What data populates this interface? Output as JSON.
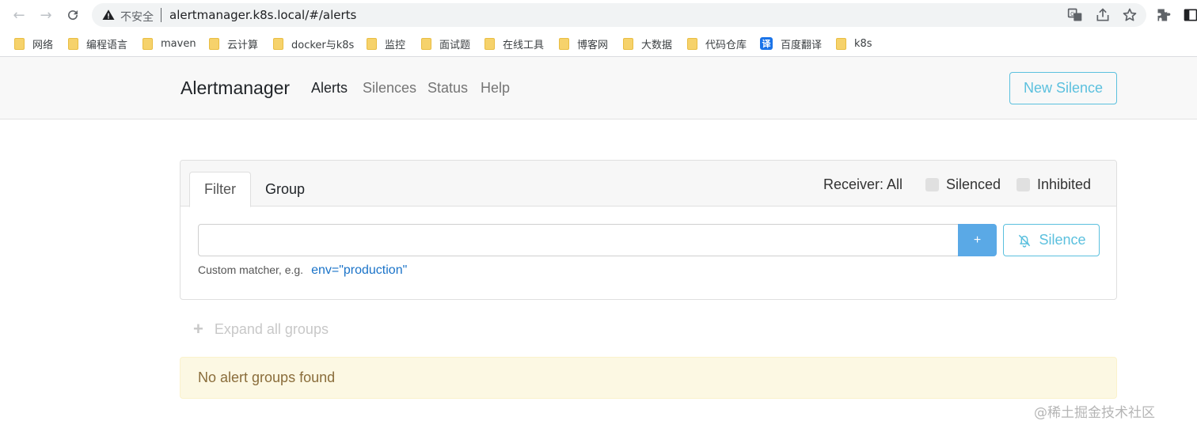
{
  "browser": {
    "security_label": "不安全",
    "url": "alertmanager.k8s.local/#/alerts",
    "icons": [
      "back-arrow-icon",
      "forward-arrow-icon",
      "reload-icon",
      "warning-icon",
      "translate-icon",
      "share-icon",
      "star-icon",
      "extensions-icon",
      "side-panel-icon"
    ]
  },
  "bookmarks": [
    {
      "label": "网络",
      "icon": "folder-icon"
    },
    {
      "label": "编程语言",
      "icon": "folder-icon"
    },
    {
      "label": "maven",
      "icon": "folder-icon"
    },
    {
      "label": "云计算",
      "icon": "folder-icon"
    },
    {
      "label": "docker与k8s",
      "icon": "folder-icon"
    },
    {
      "label": "监控",
      "icon": "folder-icon"
    },
    {
      "label": "面试题",
      "icon": "folder-icon"
    },
    {
      "label": "在线工具",
      "icon": "folder-icon"
    },
    {
      "label": "博客网",
      "icon": "folder-icon"
    },
    {
      "label": "大数据",
      "icon": "folder-icon"
    },
    {
      "label": "代码仓库",
      "icon": "folder-icon"
    },
    {
      "label": "百度翻译",
      "icon": "translate-badge-icon",
      "badge": "译"
    },
    {
      "label": "k8s",
      "icon": "folder-icon"
    }
  ],
  "navbar": {
    "brand": "Alertmanager",
    "links": [
      "Alerts",
      "Silences",
      "Status",
      "Help"
    ],
    "active": "Alerts",
    "new_silence_label": "New Silence"
  },
  "filter_card": {
    "tabs": [
      "Filter",
      "Group"
    ],
    "active_tab": "Filter",
    "receiver_label": "Receiver: All",
    "silenced_label": "Silenced",
    "inhibited_label": "Inhibited",
    "input_value": "",
    "input_placeholder": "",
    "add_label": "+",
    "silence_label": "Silence",
    "hint_text": "Custom matcher, e.g.",
    "hint_example": "env=\"production\""
  },
  "expand_all_label": "Expand all groups",
  "empty_message": "No alert groups found",
  "watermark": "@稀土掘金技术社区",
  "colors": {
    "accent": "#5bc0de",
    "add_button": "#5aa9e6",
    "warning_bg": "#fcf8e3",
    "warning_text": "#8a6d3b"
  }
}
